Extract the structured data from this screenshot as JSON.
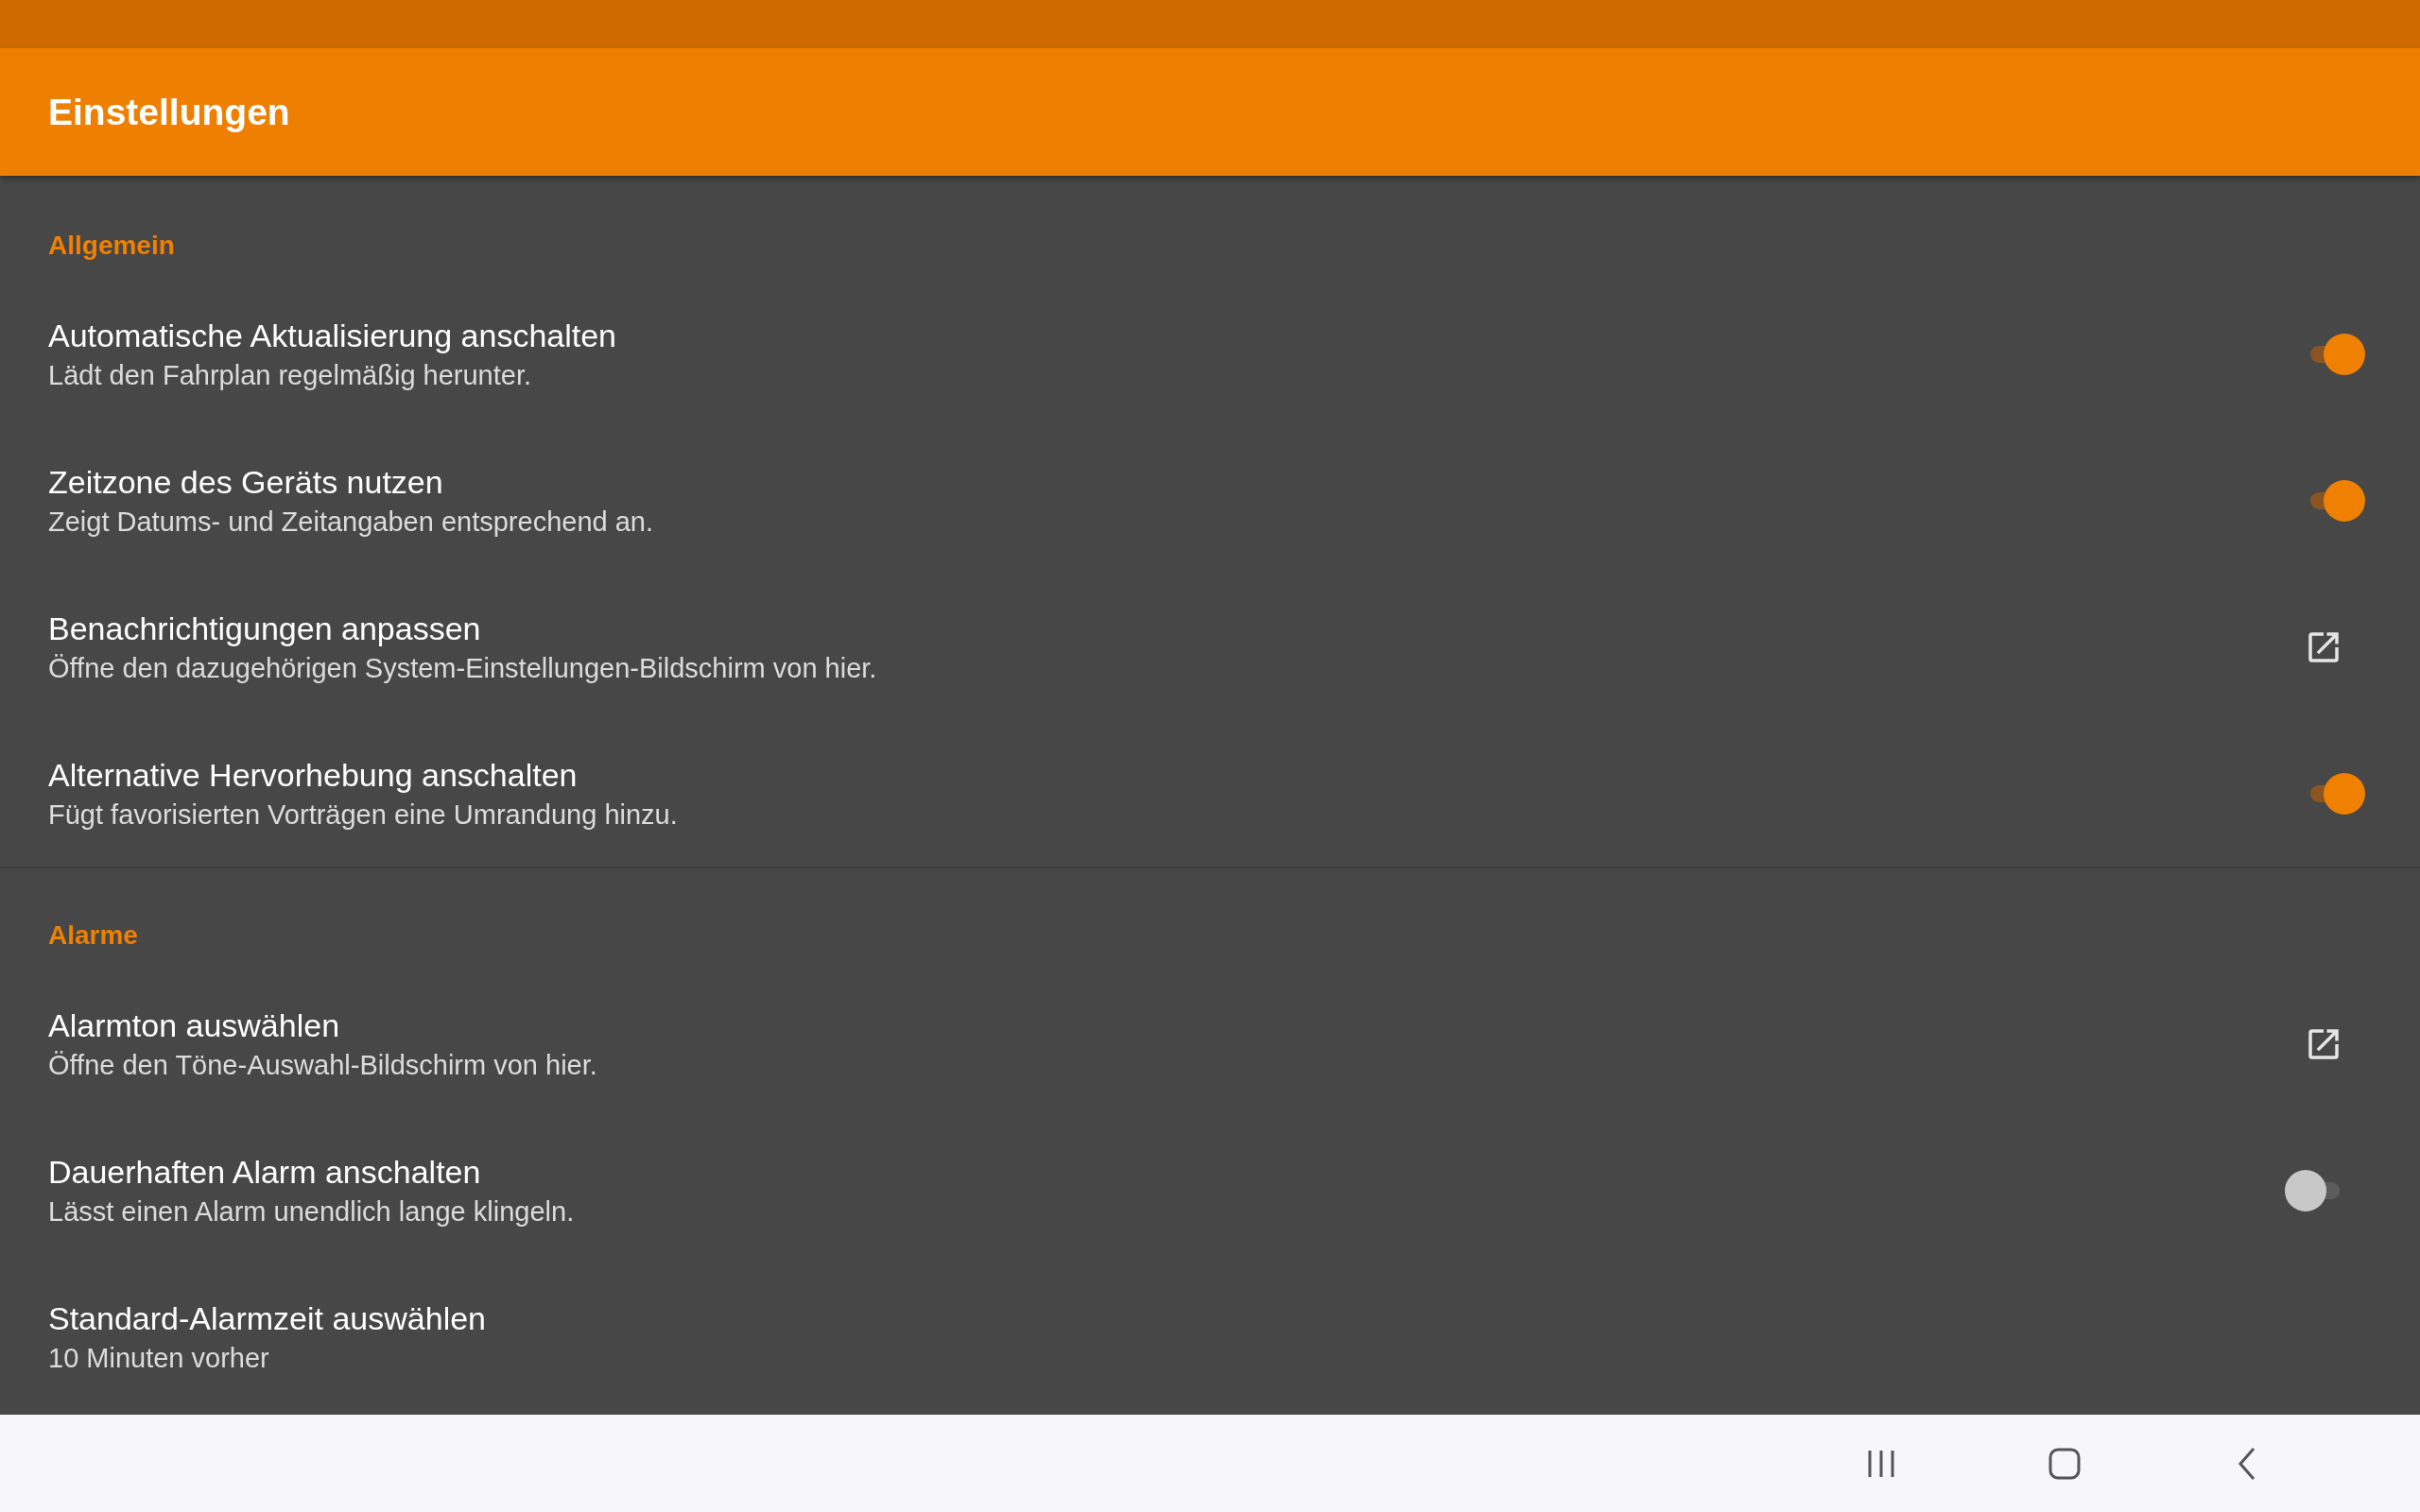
{
  "app_bar": {
    "title": "Einstellungen"
  },
  "sections": [
    {
      "title": "Allgemein",
      "items": [
        {
          "kind": "toggle",
          "title": "Automatische Aktualisierung anschalten",
          "subtitle": "Lädt den Fahrplan regelmäßig herunter.",
          "on": true
        },
        {
          "kind": "toggle",
          "title": "Zeitzone des Geräts nutzen",
          "subtitle": "Zeigt Datums- und Zeitangaben entsprechend an.",
          "on": true
        },
        {
          "kind": "link",
          "title": "Benachrichtigungen anpassen",
          "subtitle": "Öffne den dazugehörigen System-Einstellungen-Bildschirm von hier."
        },
        {
          "kind": "toggle",
          "title": "Alternative Hervorhebung anschalten",
          "subtitle": "Fügt favorisierten Vorträgen eine Umrandung hinzu.",
          "on": true
        }
      ]
    },
    {
      "title": "Alarme",
      "items": [
        {
          "kind": "link",
          "title": "Alarmton auswählen",
          "subtitle": "Öffne den Töne-Auswahl-Bildschirm von hier."
        },
        {
          "kind": "toggle",
          "title": "Dauerhaften Alarm anschalten",
          "subtitle": "Lässt einen Alarm unendlich lange klingeln.",
          "on": false
        },
        {
          "kind": "value",
          "title": "Standard-Alarmzeit auswählen",
          "subtitle": "10 Minuten vorher"
        }
      ]
    }
  ]
}
